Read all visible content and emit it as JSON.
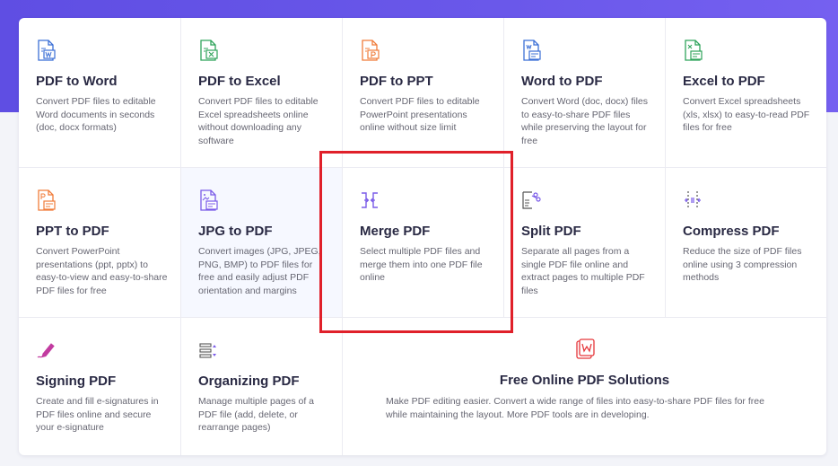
{
  "tools": [
    {
      "title": "PDF to Word",
      "desc": "Convert PDF files to editable Word documents in seconds (doc, docx formats)",
      "icon": "pdf-to-word-icon"
    },
    {
      "title": "PDF to Excel",
      "desc": "Convert PDF files to editable Excel spreadsheets online without downloading any software",
      "icon": "pdf-to-excel-icon"
    },
    {
      "title": "PDF to PPT",
      "desc": "Convert PDF files to editable PowerPoint presentations online without size limit",
      "icon": "pdf-to-ppt-icon"
    },
    {
      "title": "Word to PDF",
      "desc": "Convert Word (doc, docx) files to easy-to-share PDF files while preserving the layout for free",
      "icon": "word-to-pdf-icon"
    },
    {
      "title": "Excel to PDF",
      "desc": "Convert Excel spreadsheets (xls, xlsx) to easy-to-read PDF files for free",
      "icon": "excel-to-pdf-icon"
    },
    {
      "title": "PPT to PDF",
      "desc": "Convert PowerPoint presentations (ppt, pptx) to easy-to-view and easy-to-share PDF files for free",
      "icon": "ppt-to-pdf-icon"
    },
    {
      "title": "JPG to PDF",
      "desc": "Convert images (JPG, JPEG, PNG, BMP) to PDF files for free and easily adjust PDF orientation and margins",
      "icon": "jpg-to-pdf-icon"
    },
    {
      "title": "Merge PDF",
      "desc": "Select multiple PDF files and merge them into one PDF file online",
      "icon": "merge-pdf-icon"
    },
    {
      "title": "Split PDF",
      "desc": "Separate all pages from a single PDF file online and extract pages to multiple PDF files",
      "icon": "split-pdf-icon"
    },
    {
      "title": "Compress PDF",
      "desc": "Reduce the size of PDF files online using 3 compression methods",
      "icon": "compress-pdf-icon"
    },
    {
      "title": "Signing PDF",
      "desc": "Create and fill e-signatures in PDF files online and secure your e-signature",
      "icon": "signing-pdf-icon"
    },
    {
      "title": "Organizing PDF",
      "desc": "Manage multiple pages of a PDF file (add, delete, or rearrange pages)",
      "icon": "organizing-pdf-icon"
    }
  ],
  "solutions": {
    "title": "Free Online PDF Solutions",
    "desc": "Make PDF editing easier. Convert a wide range of files into easy-to-share PDF files for free while maintaining the layout. More PDF tools are in developing.",
    "icon": "pdf-solutions-icon"
  },
  "colors": {
    "header_band": "#6a58ea",
    "highlight_box": "#e0202a",
    "word_blue": "#3b6fd6",
    "excel_green": "#2fa35b",
    "ppt_orange": "#f07c3a",
    "purple": "#7a5be8",
    "pink": "#c23ba0",
    "red": "#e5373b"
  }
}
